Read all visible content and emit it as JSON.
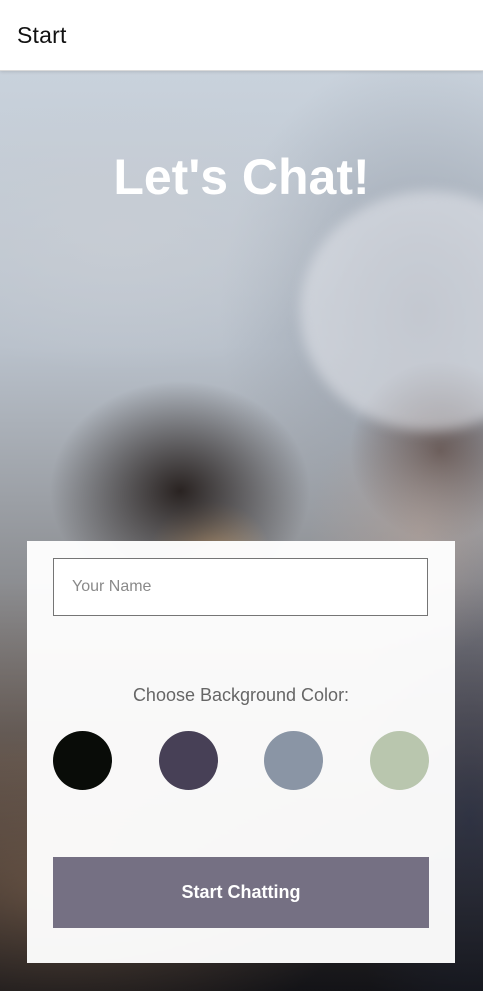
{
  "header": {
    "title": "Start"
  },
  "main": {
    "title": "Let's Chat!"
  },
  "form": {
    "name_placeholder": "Your Name",
    "name_value": "",
    "color_label": "Choose Background Color:",
    "colors": [
      {
        "name": "black",
        "hex": "#090C08"
      },
      {
        "name": "purple",
        "hex": "#474056"
      },
      {
        "name": "slate-blue",
        "hex": "#8A95A5"
      },
      {
        "name": "sage-green",
        "hex": "#B9C6AE"
      }
    ],
    "start_button_label": "Start Chatting",
    "button_color": "#757083"
  }
}
